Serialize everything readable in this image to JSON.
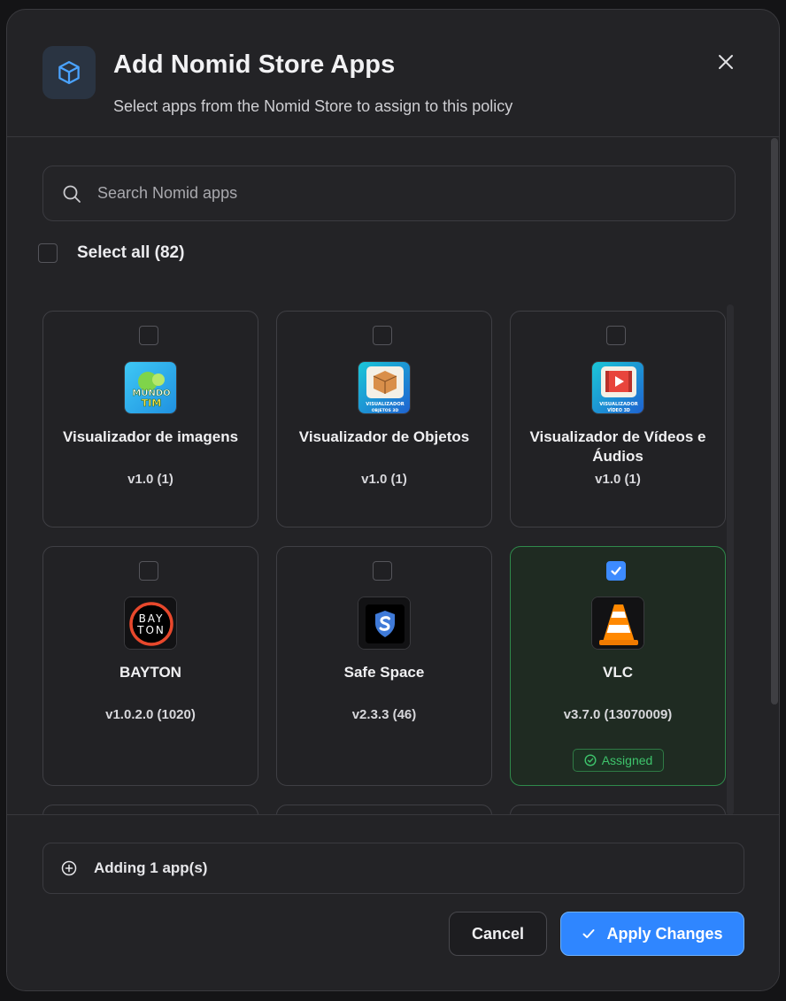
{
  "dialog": {
    "title": "Add Nomid Store Apps",
    "subtitle": "Select apps from the Nomid Store to assign to this policy",
    "header_icon": "package-icon",
    "close_icon": "close-icon"
  },
  "search": {
    "placeholder": "Search Nomid apps",
    "value": "",
    "icon": "search-icon"
  },
  "select_all": {
    "label": "Select all (82)",
    "checked": false
  },
  "apps": [
    {
      "name": "Visualizador de imagens",
      "version": "v1.0 (1)",
      "checked": false,
      "icon": "mundo-tim-icon",
      "icon_text": [
        "MUNDO",
        "TIM"
      ]
    },
    {
      "name": "Visualizador de Objetos",
      "version": "v1.0 (1)",
      "checked": false,
      "icon": "box-3d-icon",
      "icon_text": [
        "VISUALIZADOR",
        "OBJETOS 3D"
      ]
    },
    {
      "name": "Visualizador de Vídeos e Áudios",
      "version": "v1.0 (1)",
      "checked": false,
      "icon": "video-player-icon",
      "icon_text": [
        "VISUALIZADOR",
        "VÍDEO 3D"
      ]
    },
    {
      "name": "BAYTON",
      "version": "v1.0.2.0 (1020)",
      "checked": false,
      "icon": "bayton-logo-icon",
      "icon_text": [
        "BAY",
        "TON"
      ]
    },
    {
      "name": "Safe Space",
      "version": "v2.3.3 (46)",
      "checked": false,
      "icon": "shield-s-icon"
    },
    {
      "name": "VLC",
      "version": "v3.7.0 (13070009)",
      "checked": true,
      "icon": "vlc-cone-icon",
      "badge": "Assigned"
    }
  ],
  "footer": {
    "adding_label": "Adding 1 app(s)",
    "adding_icon": "plus-circle-icon",
    "cancel_label": "Cancel",
    "apply_label": "Apply Changes"
  },
  "colors": {
    "accent": "#2f86ff",
    "assigned_green": "#3ec46c",
    "background": "#232326"
  }
}
